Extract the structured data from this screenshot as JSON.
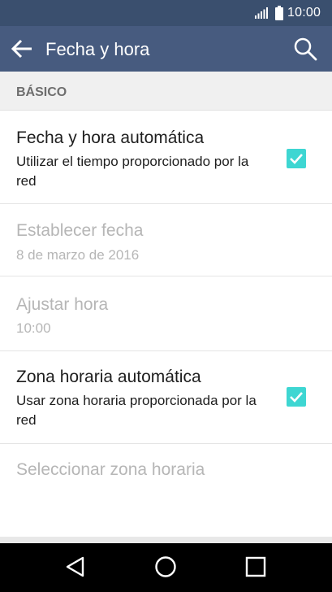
{
  "status_bar": {
    "time": "10:00",
    "icons": [
      "signal-icon",
      "battery-icon"
    ]
  },
  "app_bar": {
    "title": "Fecha y hora",
    "back_icon": "arrow-left-icon",
    "search_icon": "search-icon"
  },
  "section": {
    "label": "BÁSICO"
  },
  "rows": [
    {
      "title": "Fecha y hora automática",
      "subtitle": "Utilizar el tiempo proporcionado por la red",
      "checked": true,
      "enabled": true
    },
    {
      "title": "Establecer fecha",
      "subtitle": "8 de marzo de 2016",
      "enabled": false
    },
    {
      "title": "Ajustar hora",
      "subtitle": "10:00",
      "enabled": false
    },
    {
      "title": "Zona horaria automática",
      "subtitle": "Usar zona horaria proporcionada por la red",
      "checked": true,
      "enabled": true
    },
    {
      "title": "Seleccionar zona horaria",
      "enabled": false
    }
  ],
  "colors": {
    "status_bar": "#3a4f6e",
    "app_bar": "#475b7f",
    "accent": "#3ed6d2"
  },
  "nav_bar": {
    "icons": [
      "back-triangle-icon",
      "home-circle-icon",
      "recents-square-icon"
    ]
  }
}
